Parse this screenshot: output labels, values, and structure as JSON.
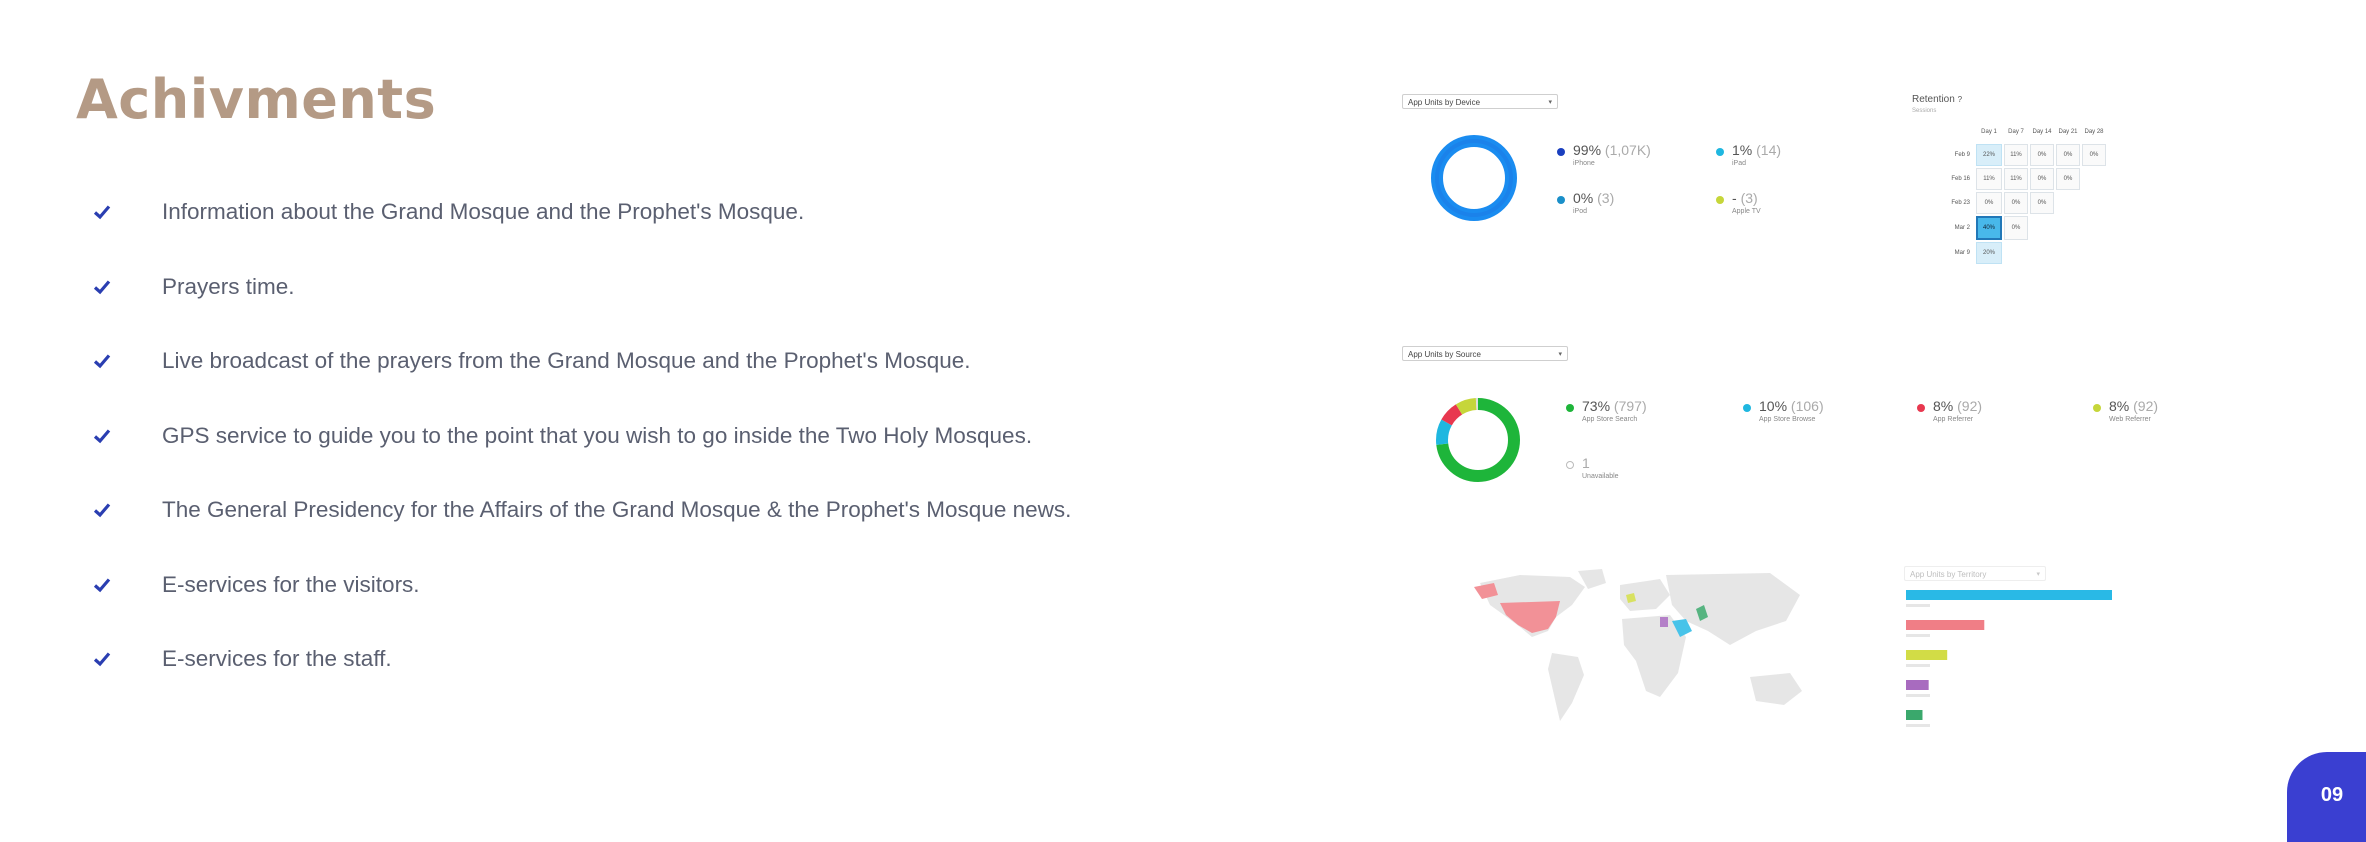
{
  "slide": {
    "title": "Achivments",
    "bullets": [
      "Information about the Grand Mosque and the Prophet's Mosque.",
      "Prayers time.",
      "Live broadcast of the prayers from the Grand Mosque and the Prophet's Mosque.",
      "GPS service to guide you to the point that you wish to go inside the Two Holy Mosques.",
      "The General Presidency for the Affairs of the Grand Mosque & the Prophet's Mosque news.",
      "E-services for the visitors.",
      "E-services for the staff."
    ],
    "page_number": "09",
    "bullet_icon": "check-icon",
    "accent_color": "#3a3fd1",
    "title_color": "#b49a85"
  },
  "analytics": {
    "device": {
      "dropdown": "App Units by Device",
      "items": [
        {
          "pct": "99%",
          "count": "(1,07K)",
          "label": "iPhone",
          "color": "#1a3fbf"
        },
        {
          "pct": "1%",
          "count": "(14)",
          "label": "iPad",
          "color": "#1fb7e0"
        },
        {
          "pct": "0%",
          "count": "(3)",
          "label": "iPod",
          "color": "#1a8fc9"
        },
        {
          "pct": "-",
          "count": "(3)",
          "label": "Apple TV",
          "color": "#c6d63a"
        }
      ],
      "donut": [
        0.99,
        0.01
      ]
    },
    "retention": {
      "title": "Retention",
      "subtitle": "Sessions",
      "columns": [
        "Day 1",
        "Day 7",
        "Day 14",
        "Day 21",
        "Day 28"
      ],
      "rows": [
        {
          "label": "Feb 9",
          "cells": [
            "22%",
            "11%",
            "0%",
            "0%",
            "0%"
          ]
        },
        {
          "label": "Feb 16",
          "cells": [
            "11%",
            "11%",
            "0%",
            "0%"
          ]
        },
        {
          "label": "Feb 23",
          "cells": [
            "0%",
            "0%",
            "0%"
          ]
        },
        {
          "label": "Mar 2",
          "cells": [
            "40%",
            "0%"
          ]
        },
        {
          "label": "Mar 9",
          "cells": [
            "20%"
          ]
        }
      ]
    },
    "source": {
      "dropdown": "App Units by Source",
      "items": [
        {
          "pct": "73%",
          "count": "(797)",
          "label": "App Store Search",
          "color": "#1eb53a"
        },
        {
          "pct": "10%",
          "count": "(106)",
          "label": "App Store Browse",
          "color": "#1fb7e0"
        },
        {
          "pct": "8%",
          "count": "(92)",
          "label": "App Referrer",
          "color": "#e8384f"
        },
        {
          "pct": "8%",
          "count": "(92)",
          "label": "Web Referrer",
          "color": "#c6d63a"
        },
        {
          "pct": "1",
          "count": "",
          "label": "Unavailable",
          "color": "#ffffff"
        }
      ],
      "donut": [
        0.73,
        0.1,
        0.08,
        0.08,
        0.01
      ]
    },
    "territory": {
      "dropdown": "App Units by Territory",
      "bars": [
        {
          "value": 1.0,
          "color": "#29b9e6"
        },
        {
          "value": 0.38,
          "color": "#f07e86"
        },
        {
          "value": 0.2,
          "color": "#d2dc46"
        },
        {
          "value": 0.11,
          "color": "#a86bbf"
        },
        {
          "value": 0.08,
          "color": "#3aa86c"
        }
      ]
    }
  }
}
